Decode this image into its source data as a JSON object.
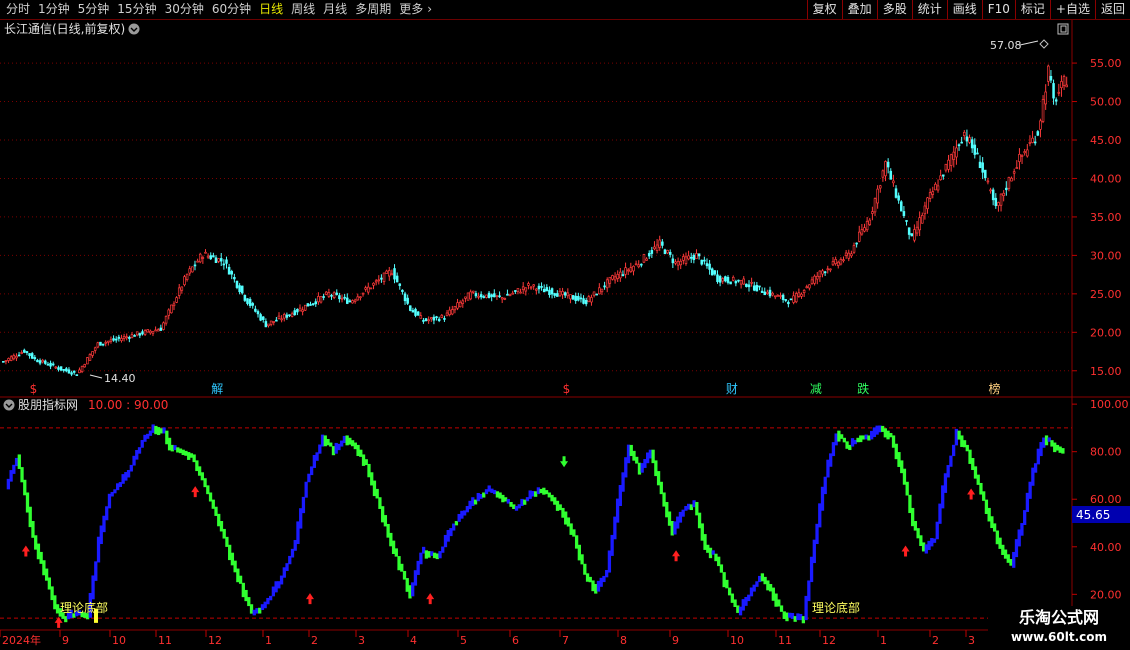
{
  "toolbar": {
    "periods": [
      "分时",
      "1分钟",
      "5分钟",
      "15分钟",
      "30分钟",
      "60分钟",
      "日线",
      "周线",
      "月线",
      "多周期"
    ],
    "active_period": "日线",
    "more_label": "更多",
    "buttons": [
      "复权",
      "叠加",
      "多股",
      "统计",
      "画线",
      "F10",
      "标记",
      "+自选",
      "返回"
    ]
  },
  "main_panel": {
    "title": "长江通信(日线,前复权)",
    "high_label": "57.08",
    "low_label": "14.40",
    "event_markers": [
      {
        "label": "$",
        "color": "#ff3030",
        "x_index": 12
      },
      {
        "label": "解",
        "color": "#30c8ff",
        "x_index": 82
      },
      {
        "label": "$",
        "color": "#ff3030",
        "x_index": 215
      },
      {
        "label": "财",
        "color": "#30c8ff",
        "x_index": 278
      },
      {
        "label": "减",
        "color": "#30ff60",
        "x_index": 310
      },
      {
        "label": "跌",
        "color": "#30ff60",
        "x_index": 328
      },
      {
        "label": "榜",
        "color": "#ffd080",
        "x_index": 378
      }
    ]
  },
  "indicator_panel": {
    "title": "股朋指标网",
    "params": "10.00 : 90.00",
    "value_box": "45.65",
    "bottom_label_1": "理论底部",
    "bottom_label_2": "理论底部"
  },
  "time_axis": {
    "labels": [
      "2024年",
      "9",
      "10",
      "11",
      "12",
      "1",
      "2",
      "3",
      "4",
      "5",
      "6",
      "7",
      "8",
      "9",
      "10",
      "11",
      "12",
      "1",
      "2",
      "3"
    ]
  },
  "chart_data": [
    {
      "type": "candlestick",
      "title": "长江通信(日线,前复权)",
      "ylim": [
        12.5,
        58
      ],
      "yticks": [
        15.0,
        20.0,
        25.0,
        30.0,
        35.0,
        40.0,
        45.0,
        50.0,
        55.0
      ],
      "close_anchors": [
        [
          0,
          16.2
        ],
        [
          8,
          17.6
        ],
        [
          12,
          16.5
        ],
        [
          22,
          15.2
        ],
        [
          28,
          14.6
        ],
        [
          36,
          18.5
        ],
        [
          48,
          19.5
        ],
        [
          60,
          20.5
        ],
        [
          70,
          27.5
        ],
        [
          76,
          30.2
        ],
        [
          84,
          29.2
        ],
        [
          92,
          24.5
        ],
        [
          100,
          21.0
        ],
        [
          110,
          22.5
        ],
        [
          124,
          25.0
        ],
        [
          132,
          24.0
        ],
        [
          140,
          26.0
        ],
        [
          148,
          28.0
        ],
        [
          155,
          23.0
        ],
        [
          160,
          21.5
        ],
        [
          168,
          22.0
        ],
        [
          178,
          25.0
        ],
        [
          190,
          24.5
        ],
        [
          200,
          26.0
        ],
        [
          212,
          25.0
        ],
        [
          222,
          24.0
        ],
        [
          232,
          27.0
        ],
        [
          242,
          29.0
        ],
        [
          250,
          31.5
        ],
        [
          256,
          29.0
        ],
        [
          264,
          30.0
        ],
        [
          272,
          27.0
        ],
        [
          282,
          26.5
        ],
        [
          292,
          25.0
        ],
        [
          300,
          24.0
        ],
        [
          312,
          28.0
        ],
        [
          322,
          30.0
        ],
        [
          330,
          35.0
        ],
        [
          336,
          42.0
        ],
        [
          340,
          38.0
        ],
        [
          346,
          32.0
        ],
        [
          352,
          37.0
        ],
        [
          360,
          42.0
        ],
        [
          366,
          46.0
        ],
        [
          372,
          42.0
        ],
        [
          378,
          36.0
        ],
        [
          386,
          42.0
        ],
        [
          394,
          46.0
        ],
        [
          398,
          54.0
        ],
        [
          400,
          50.0
        ],
        [
          405,
          53.0
        ]
      ],
      "n": 406
    },
    {
      "type": "line",
      "title": "股朋指标网",
      "ylim": [
        5,
        103
      ],
      "yticks": [
        20.0,
        40.0,
        60.0,
        80.0,
        100.0
      ],
      "reference_lines": [
        10,
        90
      ],
      "last_value": 45.65,
      "anchors": [
        [
          0,
          65
        ],
        [
          4,
          78
        ],
        [
          7,
          62
        ],
        [
          10,
          44
        ],
        [
          14,
          30
        ],
        [
          18,
          15
        ],
        [
          21,
          10
        ],
        [
          26,
          12
        ],
        [
          30,
          11
        ],
        [
          34,
          42
        ],
        [
          38,
          62
        ],
        [
          44,
          70
        ],
        [
          50,
          85
        ],
        [
          54,
          90
        ],
        [
          58,
          88
        ],
        [
          60,
          82
        ],
        [
          64,
          80
        ],
        [
          68,
          78
        ],
        [
          72,
          68
        ],
        [
          78,
          50
        ],
        [
          84,
          30
        ],
        [
          88,
          18
        ],
        [
          90,
          12
        ],
        [
          94,
          15
        ],
        [
          100,
          25
        ],
        [
          106,
          42
        ],
        [
          110,
          68
        ],
        [
          116,
          86
        ],
        [
          120,
          80
        ],
        [
          124,
          86
        ],
        [
          128,
          82
        ],
        [
          132,
          74
        ],
        [
          136,
          60
        ],
        [
          140,
          45
        ],
        [
          144,
          32
        ],
        [
          148,
          20
        ],
        [
          152,
          38
        ],
        [
          158,
          36
        ],
        [
          164,
          50
        ],
        [
          170,
          58
        ],
        [
          176,
          64
        ],
        [
          180,
          62
        ],
        [
          186,
          56
        ],
        [
          192,
          62
        ],
        [
          196,
          64
        ],
        [
          200,
          60
        ],
        [
          204,
          54
        ],
        [
          208,
          44
        ],
        [
          212,
          28
        ],
        [
          216,
          22
        ],
        [
          220,
          30
        ],
        [
          224,
          58
        ],
        [
          228,
          82
        ],
        [
          232,
          72
        ],
        [
          236,
          80
        ],
        [
          240,
          62
        ],
        [
          244,
          46
        ],
        [
          248,
          56
        ],
        [
          252,
          58
        ],
        [
          256,
          40
        ],
        [
          260,
          35
        ],
        [
          264,
          22
        ],
        [
          268,
          12
        ],
        [
          272,
          20
        ],
        [
          276,
          28
        ],
        [
          280,
          22
        ],
        [
          284,
          12
        ],
        [
          288,
          10
        ],
        [
          292,
          10
        ],
        [
          296,
          42
        ],
        [
          300,
          70
        ],
        [
          304,
          88
        ],
        [
          308,
          82
        ],
        [
          312,
          86
        ],
        [
          316,
          86
        ],
        [
          320,
          90
        ],
        [
          324,
          86
        ],
        [
          328,
          72
        ],
        [
          332,
          50
        ],
        [
          336,
          38
        ],
        [
          340,
          44
        ],
        [
          344,
          70
        ],
        [
          348,
          88
        ],
        [
          352,
          80
        ],
        [
          356,
          66
        ],
        [
          360,
          52
        ],
        [
          364,
          40
        ],
        [
          368,
          32
        ],
        [
          372,
          50
        ],
        [
          376,
          72
        ],
        [
          380,
          86
        ],
        [
          384,
          82
        ],
        [
          387,
          80
        ]
      ],
      "n": 388
    }
  ]
}
